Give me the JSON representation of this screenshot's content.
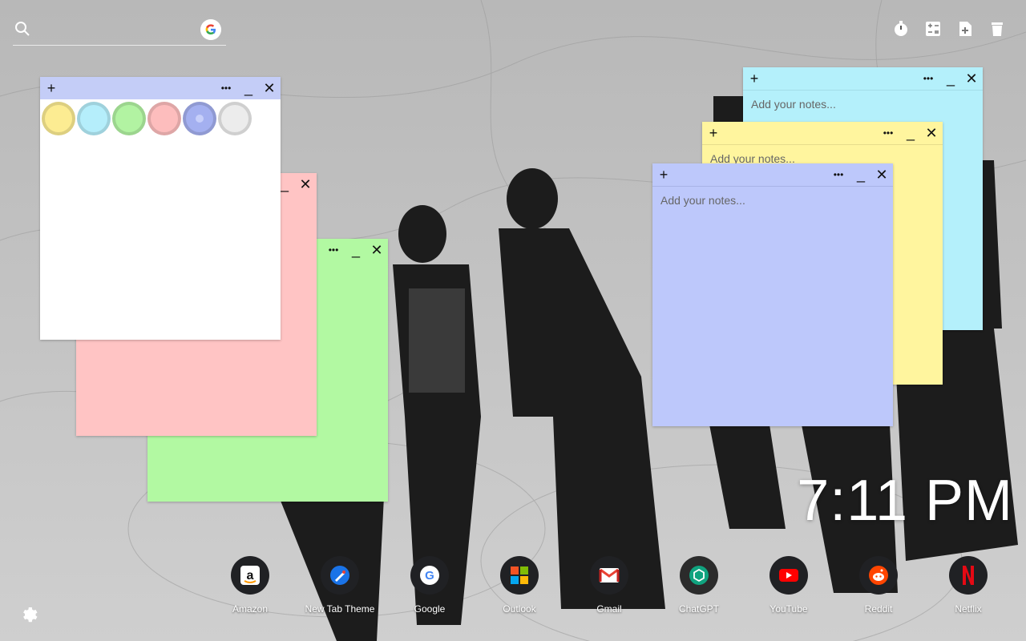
{
  "search": {
    "value": "",
    "placeholder": ""
  },
  "top_tools": [
    {
      "icon": "stopwatch-icon"
    },
    {
      "icon": "calculator-icon"
    },
    {
      "icon": "add-note-icon"
    },
    {
      "icon": "trash-icon"
    }
  ],
  "notes": {
    "white": {
      "color": "#ffffff",
      "bar_color": "#c4cdf7",
      "placeholder": ""
    },
    "pink": {
      "color": "#ffc4c4",
      "bar_color": "#ffc4c4",
      "placeholder": ""
    },
    "green": {
      "color": "#b2f9a2",
      "bar_color": "#b2f9a2",
      "placeholder": ""
    },
    "cyan": {
      "color": "#b4f0fb",
      "bar_color": "#b4f0fb",
      "placeholder": "Add your notes..."
    },
    "yellow": {
      "color": "#fff59e",
      "bar_color": "#fff59e",
      "placeholder": "Add your notes..."
    },
    "blue": {
      "color": "#bdc8fb",
      "bar_color": "#bdc8fb",
      "placeholder": "Add your notes..."
    }
  },
  "note_controls": {
    "add": "+",
    "menu": "•••",
    "minimize": "_",
    "close": "✕"
  },
  "swatches": [
    "#fcec92",
    "#b5eefb",
    "#b2f3a2",
    "#fdbdbd",
    "#a4b0f0",
    "#ececec"
  ],
  "clock": "7:11 PM",
  "shortcuts": [
    {
      "label": "Amazon",
      "icon": "amazon-icon"
    },
    {
      "label": "New Tab Theme",
      "icon": "new-tab-theme-icon"
    },
    {
      "label": "Google",
      "icon": "google-icon"
    },
    {
      "label": "Outlook",
      "icon": "outlook-icon"
    },
    {
      "label": "Gmail",
      "icon": "gmail-icon"
    },
    {
      "label": "ChatGPT",
      "icon": "chatgpt-icon"
    },
    {
      "label": "YouTube",
      "icon": "youtube-icon"
    },
    {
      "label": "Reddit",
      "icon": "reddit-icon"
    },
    {
      "label": "Netflix",
      "icon": "netflix-icon"
    }
  ]
}
